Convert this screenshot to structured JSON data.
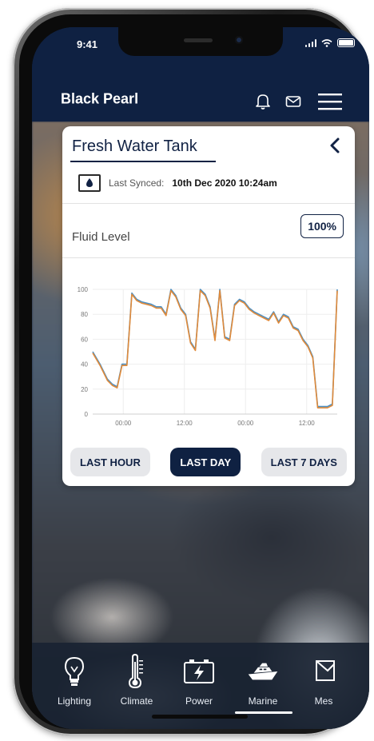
{
  "status_bar": {
    "time": "9:41"
  },
  "app": {
    "title": "Black Pearl"
  },
  "card": {
    "title": "Fresh Water Tank",
    "sync_label": "Last Synced:",
    "sync_value": "10th Dec 2020 10:24am",
    "fluid_label": "Fluid Level",
    "fluid_value": "100%",
    "range_buttons": [
      "LAST HOUR",
      "LAST DAY",
      "LAST 7 DAYS"
    ],
    "active_range": "LAST DAY"
  },
  "chart_data": {
    "type": "line",
    "xlabel": "",
    "ylabel": "",
    "y_ticks": [
      "0",
      "20",
      "40",
      "60",
      "80",
      "100"
    ],
    "x_ticks": [
      "00:00",
      "12:00",
      "00:00",
      "12:00"
    ],
    "ylim": [
      0,
      100
    ],
    "x": [
      0,
      3,
      6,
      8,
      10,
      12,
      14,
      16,
      18,
      20,
      22,
      24,
      26,
      28,
      30,
      32,
      34,
      36,
      38,
      40,
      42,
      44,
      46,
      48,
      50,
      52,
      54,
      56,
      58,
      60,
      62,
      64,
      66,
      68,
      70,
      72,
      74,
      76,
      78,
      80,
      82,
      84,
      86,
      88,
      90,
      92,
      94,
      96,
      98,
      100
    ],
    "series": [
      {
        "color": "#4a8fc4",
        "values": [
          50,
          40,
          28,
          24,
          22,
          40,
          40,
          97,
          92,
          90,
          89,
          88,
          86,
          86,
          80,
          100,
          95,
          85,
          80,
          58,
          52,
          100,
          96,
          86,
          60,
          100,
          62,
          60,
          88,
          92,
          90,
          85,
          82,
          80,
          78,
          76,
          82,
          74,
          80,
          78,
          70,
          68,
          60,
          55,
          46,
          6,
          6,
          6,
          8,
          100
        ]
      },
      {
        "color": "#e08a3a",
        "values": [
          49,
          39,
          27,
          23,
          21,
          39,
          39,
          96,
          91,
          89,
          88,
          87,
          85,
          85,
          79,
          99,
          94,
          84,
          79,
          57,
          51,
          99,
          95,
          85,
          59,
          99,
          61,
          59,
          87,
          91,
          89,
          84,
          81,
          79,
          77,
          75,
          81,
          73,
          79,
          77,
          69,
          67,
          59,
          54,
          45,
          5,
          5,
          5,
          7,
          99
        ]
      }
    ]
  },
  "nav": {
    "items": [
      {
        "label": "Lighting",
        "icon": "lightbulb-icon"
      },
      {
        "label": "Climate",
        "icon": "thermometer-icon"
      },
      {
        "label": "Power",
        "icon": "battery-bolt-icon"
      },
      {
        "label": "Marine",
        "icon": "yacht-icon"
      },
      {
        "label": "Mes",
        "icon": "message-icon"
      }
    ],
    "active": "Marine"
  },
  "colors": {
    "primary": "#0f2142",
    "accent": "#e08a3a",
    "secondary_line": "#4a8fc4"
  }
}
